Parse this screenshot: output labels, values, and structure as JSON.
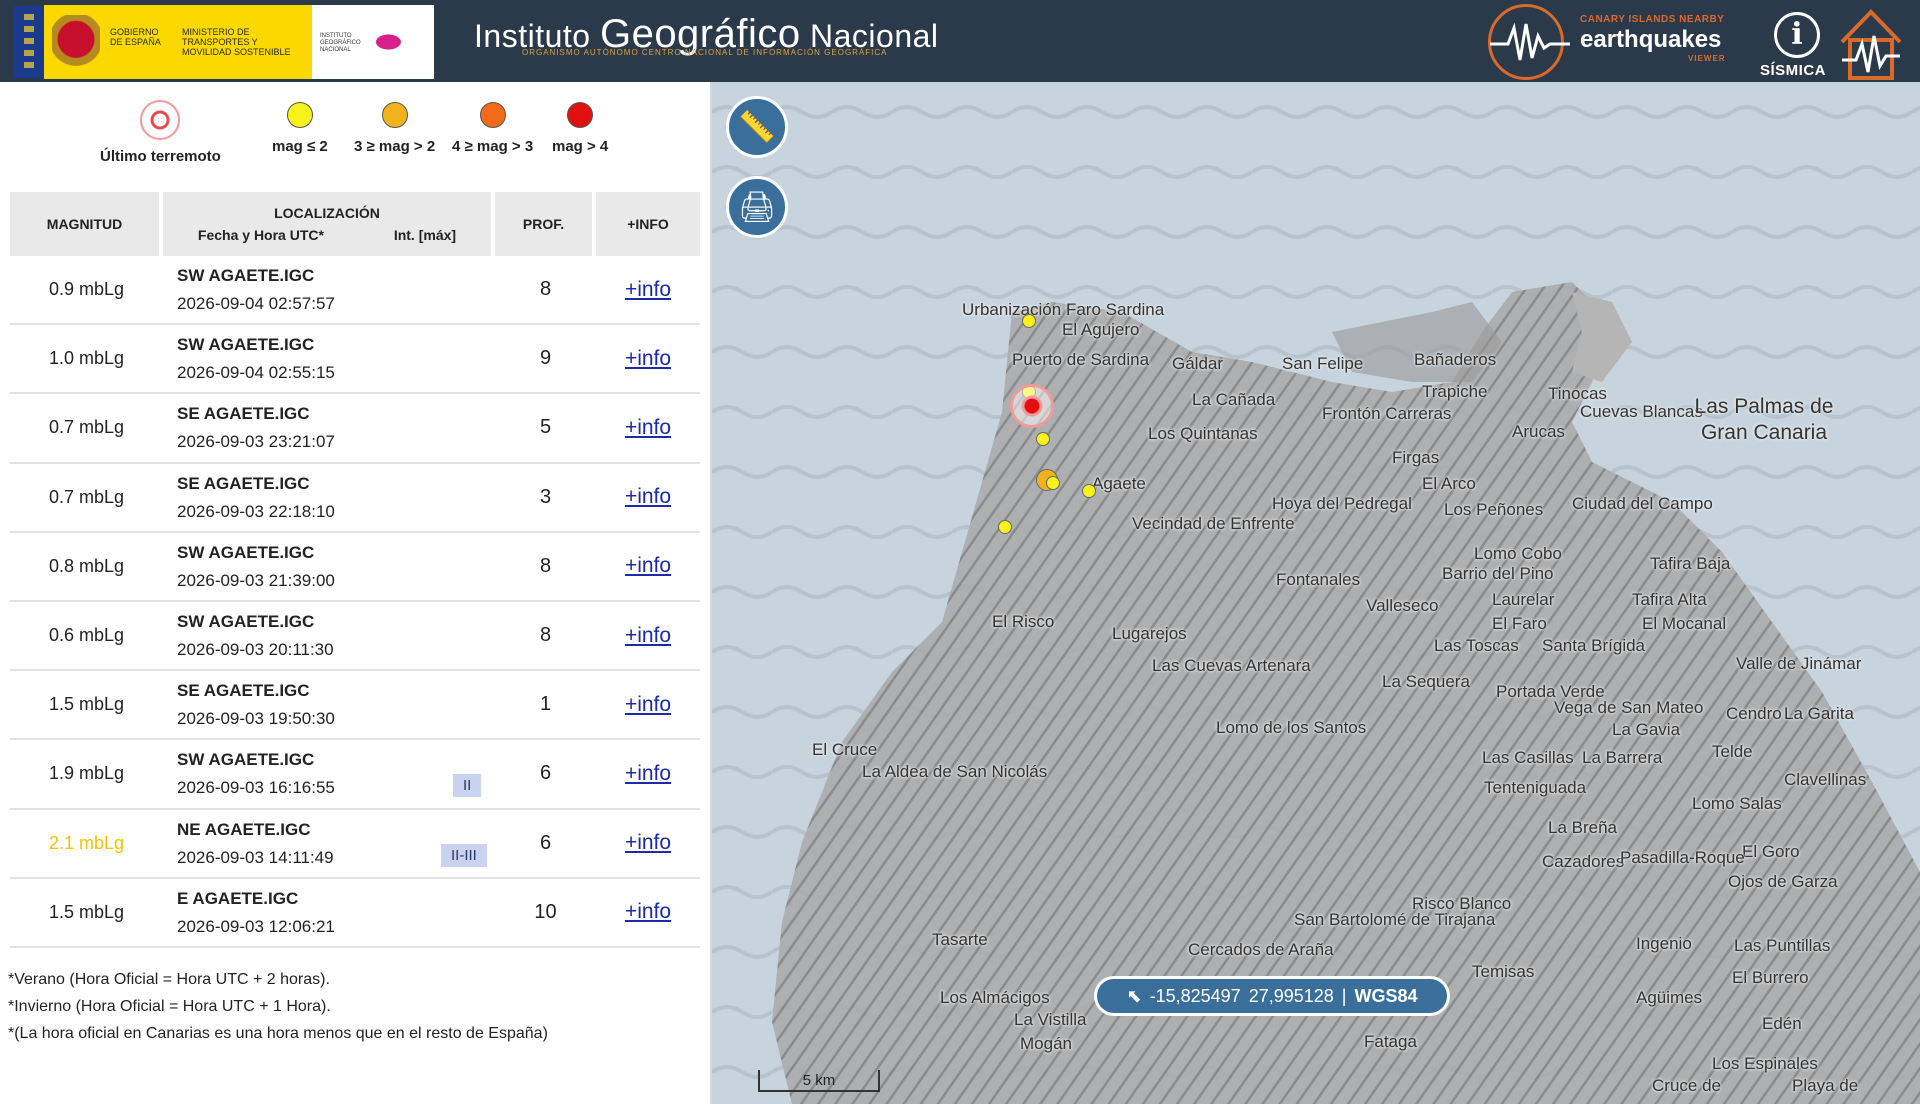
{
  "header": {
    "gov_text": "Gobierno de España",
    "ministry_text": "Ministerio de Transportes y Movilidad Sostenible",
    "ign_small": "Instituto Geográfico Nacional",
    "title_part1": "Instituto ",
    "title_part2": "Geográfico",
    "title_part3": " Nacional",
    "subtitle": "Organismo Autónomo  Centro Nacional de Información Geográfica",
    "ceq_top": "CANARY ISLANDS NEARBY",
    "ceq_main": "earthquakes",
    "ceq_bottom": "VIEWER",
    "info_glyph": "i",
    "sismica": "SÍSMICA"
  },
  "legend": {
    "last": "Último terremoto",
    "items": [
      "mag ≤ 2",
      "3 ≥ mag > 2",
      "4 ≥ mag > 3",
      "mag > 4"
    ],
    "colors": [
      "#f7f21a",
      "#f2b21e",
      "#f26a1a",
      "#e01010"
    ]
  },
  "table": {
    "headers": {
      "mag": "MAGNITUD",
      "loc": "LOCALIZACIÓN",
      "date": "Fecha y Hora UTC*",
      "int": "Int. [máx]",
      "prof": "PROF.",
      "info": "+INFO"
    },
    "rows": [
      {
        "mag": "0.9 mbLg",
        "place": "SW AGAETE.IGC",
        "dt": "2026-09-04 02:57:57",
        "int": "",
        "prof": "8",
        "info": "+info"
      },
      {
        "mag": "1.0 mbLg",
        "place": "SW AGAETE.IGC",
        "dt": "2026-09-04 02:55:15",
        "int": "",
        "prof": "9",
        "info": "+info"
      },
      {
        "mag": "0.7 mbLg",
        "place": "SE AGAETE.IGC",
        "dt": "2026-09-03 23:21:07",
        "int": "",
        "prof": "5",
        "info": "+info"
      },
      {
        "mag": "0.7 mbLg",
        "place": "SE AGAETE.IGC",
        "dt": "2026-09-03 22:18:10",
        "int": "",
        "prof": "3",
        "info": "+info"
      },
      {
        "mag": "0.8 mbLg",
        "place": "SW AGAETE.IGC",
        "dt": "2026-09-03 21:39:00",
        "int": "",
        "prof": "8",
        "info": "+info"
      },
      {
        "mag": "0.6 mbLg",
        "place": "SW AGAETE.IGC",
        "dt": "2026-09-03 20:11:30",
        "int": "",
        "prof": "8",
        "info": "+info"
      },
      {
        "mag": "1.5 mbLg",
        "place": "SE AGAETE.IGC",
        "dt": "2026-09-03 19:50:30",
        "int": "",
        "prof": "1",
        "info": "+info"
      },
      {
        "mag": "1.9 mbLg",
        "place": "SW AGAETE.IGC",
        "dt": "2026-09-03 16:16:55",
        "int": "II",
        "prof": "6",
        "info": "+info"
      },
      {
        "mag": "2.1 mbLg",
        "place": "NE AGAETE.IGC",
        "dt": "2026-09-03 14:11:49",
        "int": "II-III",
        "prof": "6",
        "info": "+info",
        "highlight": true
      },
      {
        "mag": "1.5 mbLg",
        "place": "E AGAETE.IGC",
        "dt": "2026-09-03 12:06:21",
        "int": "",
        "prof": "10",
        "info": "+info"
      }
    ]
  },
  "notes": [
    "*Verano (Hora Oficial = Hora UTC + 2 horas).",
    "*Invierno (Hora Oficial = Hora UTC + 1 Hora).",
    "*(La hora oficial en Canarias es una hora menos que en el resto de España)"
  ],
  "map": {
    "buttons": {
      "ruler": "ruler-icon",
      "print": "printer-icon"
    },
    "coord_lon": "-15,825497",
    "coord_lat": "27,995128",
    "coord_sys": "WGS84",
    "scale": "5 km",
    "places": [
      "Urbanización Faro Sardina",
      "El Agujero",
      "Puerto de Sardina",
      "Gáldar",
      "San Felipe",
      "Bañaderos",
      "La Cañada",
      "Trapiche",
      "Tinocas",
      "Frontón Carreras",
      "Arucas",
      "Cuevas Blancas",
      "Las Palmas de Gran Canaria",
      "Los Quintanas",
      "Firgas",
      "Agaete",
      "El Arco",
      "Hoya del Pedregal",
      "Los Peñones",
      "Ciudad del Campo",
      "Vecindad de Enfrente",
      "Lomo Cobo",
      "Tafira Baja",
      "Barrio del Pino",
      "Fontanales",
      "Laurelar",
      "Tafira Alta",
      "Valleseco",
      "El Faro",
      "El Mocanal",
      "El Risco",
      "Lugarejos",
      "Las Toscas",
      "Santa Brígida",
      "Valle de Jinámar",
      "Las Cuevas Artenara",
      "La Sequera",
      "Portada Verde",
      "Vega de San Mateo",
      "La Gavia",
      "Cendro",
      "La Garita",
      "El Cruce",
      "Lomo de los Santos",
      "Telde",
      "La Aldea de San Nicolás",
      "Las Casillas",
      "La Barrera",
      "Tenteniguada",
      "Clavellinas",
      "Lomo Salas",
      "La Breña",
      "El Goro",
      "Cazadores",
      "Pasadilla-Roque",
      "Ojos de Garza",
      "Risco Blanco",
      "Tasarte",
      "San Bartolomé de Tirajana",
      "Cercados de Araña",
      "Ingenio",
      "Las Puntillas",
      "Temisas",
      "El Burrero",
      "Los Almácigos",
      "Agüimes",
      "La Vistilla",
      "Mogán",
      "Fataga",
      "Edén",
      "Los Espinales",
      "Cruce de",
      "Playa de"
    ]
  }
}
